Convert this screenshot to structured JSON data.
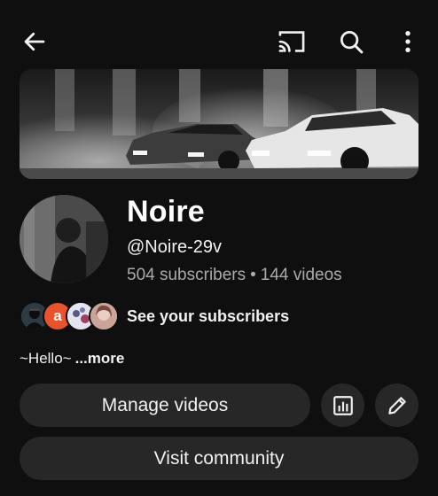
{
  "toolbar": {
    "back_icon": "arrow-left-icon",
    "cast_icon": "cast-icon",
    "search_icon": "search-icon",
    "more_icon": "more-vertical-icon"
  },
  "channel": {
    "name": "Noire",
    "handle": "@Noire-29v",
    "subscribers": "504 subscribers",
    "separator": "•",
    "videos": "144 videos"
  },
  "subscribers_row": {
    "avatar_letter": "a",
    "label": "See your subscribers"
  },
  "description": {
    "text": "~Hello~",
    "more_label": "...more"
  },
  "actions": {
    "manage_videos": "Manage videos",
    "analytics_icon": "analytics-icon",
    "edit_icon": "pencil-icon",
    "visit_community": "Visit community"
  },
  "colors": {
    "background": "#0f0f0f",
    "button": "#272727",
    "text": "#f1f1f1",
    "secondary_text": "#aaaaaa",
    "avatar_orange": "#e8532c"
  }
}
